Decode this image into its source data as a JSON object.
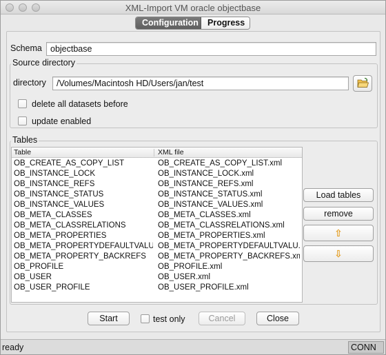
{
  "window": {
    "title": "XML-Import VM oracle objectbase"
  },
  "tabs": [
    {
      "label": "Configuration",
      "active": true
    },
    {
      "label": "Progress",
      "active": false
    }
  ],
  "schema": {
    "label": "Schema",
    "value": "objectbase"
  },
  "source_directory": {
    "group_title": "Source directory",
    "directory_label": "directory",
    "directory_value": "/Volumes/Macintosh HD/Users/jan/test",
    "browse_icon": "folder-open-icon",
    "delete_all_label": "delete all datasets before",
    "delete_all_checked": false,
    "update_enabled_label": "update enabled",
    "update_enabled_checked": false
  },
  "tables": {
    "group_title": "Tables",
    "columns": [
      "Table",
      "XML file"
    ],
    "rows": [
      [
        "OB_CREATE_AS_COPY_LIST",
        "OB_CREATE_AS_COPY_LIST.xml"
      ],
      [
        "OB_INSTANCE_LOCK",
        "OB_INSTANCE_LOCK.xml"
      ],
      [
        "OB_INSTANCE_REFS",
        "OB_INSTANCE_REFS.xml"
      ],
      [
        "OB_INSTANCE_STATUS",
        "OB_INSTANCE_STATUS.xml"
      ],
      [
        "OB_INSTANCE_VALUES",
        "OB_INSTANCE_VALUES.xml"
      ],
      [
        "OB_META_CLASSES",
        "OB_META_CLASSES.xml"
      ],
      [
        "OB_META_CLASSRELATIONS",
        "OB_META_CLASSRELATIONS.xml"
      ],
      [
        "OB_META_PROPERTIES",
        "OB_META_PROPERTIES.xml"
      ],
      [
        "OB_META_PROPERTYDEFAULTVALUES",
        "OB_META_PROPERTYDEFAULTVALU..."
      ],
      [
        "OB_META_PROPERTY_BACKREFS",
        "OB_META_PROPERTY_BACKREFS.xml"
      ],
      [
        "OB_PROFILE",
        "OB_PROFILE.xml"
      ],
      [
        "OB_USER",
        "OB_USER.xml"
      ],
      [
        "OB_USER_PROFILE",
        "OB_USER_PROFILE.xml"
      ]
    ],
    "load_tables_label": "Load tables",
    "remove_label": "remove",
    "move_up_icon": "arrow-up-icon",
    "move_down_icon": "arrow-down-icon",
    "move_up_glyph": "⇧",
    "move_down_glyph": "⇩"
  },
  "actions": {
    "start_label": "Start",
    "test_only_label": "test only",
    "test_only_checked": false,
    "cancel_label": "Cancel",
    "cancel_enabled": false,
    "close_label": "Close"
  },
  "statusbar": {
    "status": "ready",
    "connection": "CONN"
  }
}
